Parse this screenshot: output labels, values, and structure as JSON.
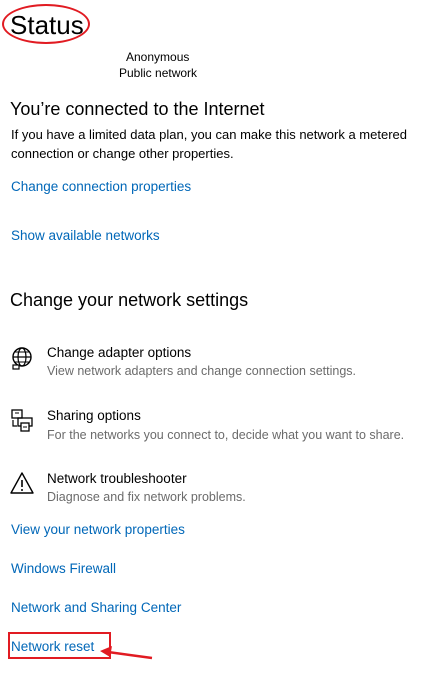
{
  "page": {
    "title": "Status"
  },
  "network": {
    "name": "Anonymous",
    "type": "Public network"
  },
  "connection": {
    "heading": "You’re connected to the Internet",
    "description": "If you have a limited data plan, you can make this network a metered connection or change other properties.",
    "links": {
      "change_properties": "Change connection properties",
      "show_networks": "Show available networks"
    }
  },
  "settings": {
    "heading": "Change your network settings",
    "options": [
      {
        "title": "Change adapter options",
        "subtitle": "View network adapters and change connection settings.",
        "icon": "globe-adapter-icon"
      },
      {
        "title": "Sharing options",
        "subtitle": "For the networks you connect to, decide what you want to share.",
        "icon": "sharing-printer-icon"
      },
      {
        "title": "Network troubleshooter",
        "subtitle": "Diagnose and fix network problems.",
        "icon": "warning-triangle-icon"
      }
    ]
  },
  "links": {
    "view_properties": "View your network properties",
    "firewall": "Windows Firewall",
    "sharing_center": "Network and Sharing Center",
    "network_reset": "Network reset"
  },
  "colors": {
    "link": "#0067b8",
    "annotation": "#e11b22",
    "secondary_text": "#6b6b6b"
  }
}
